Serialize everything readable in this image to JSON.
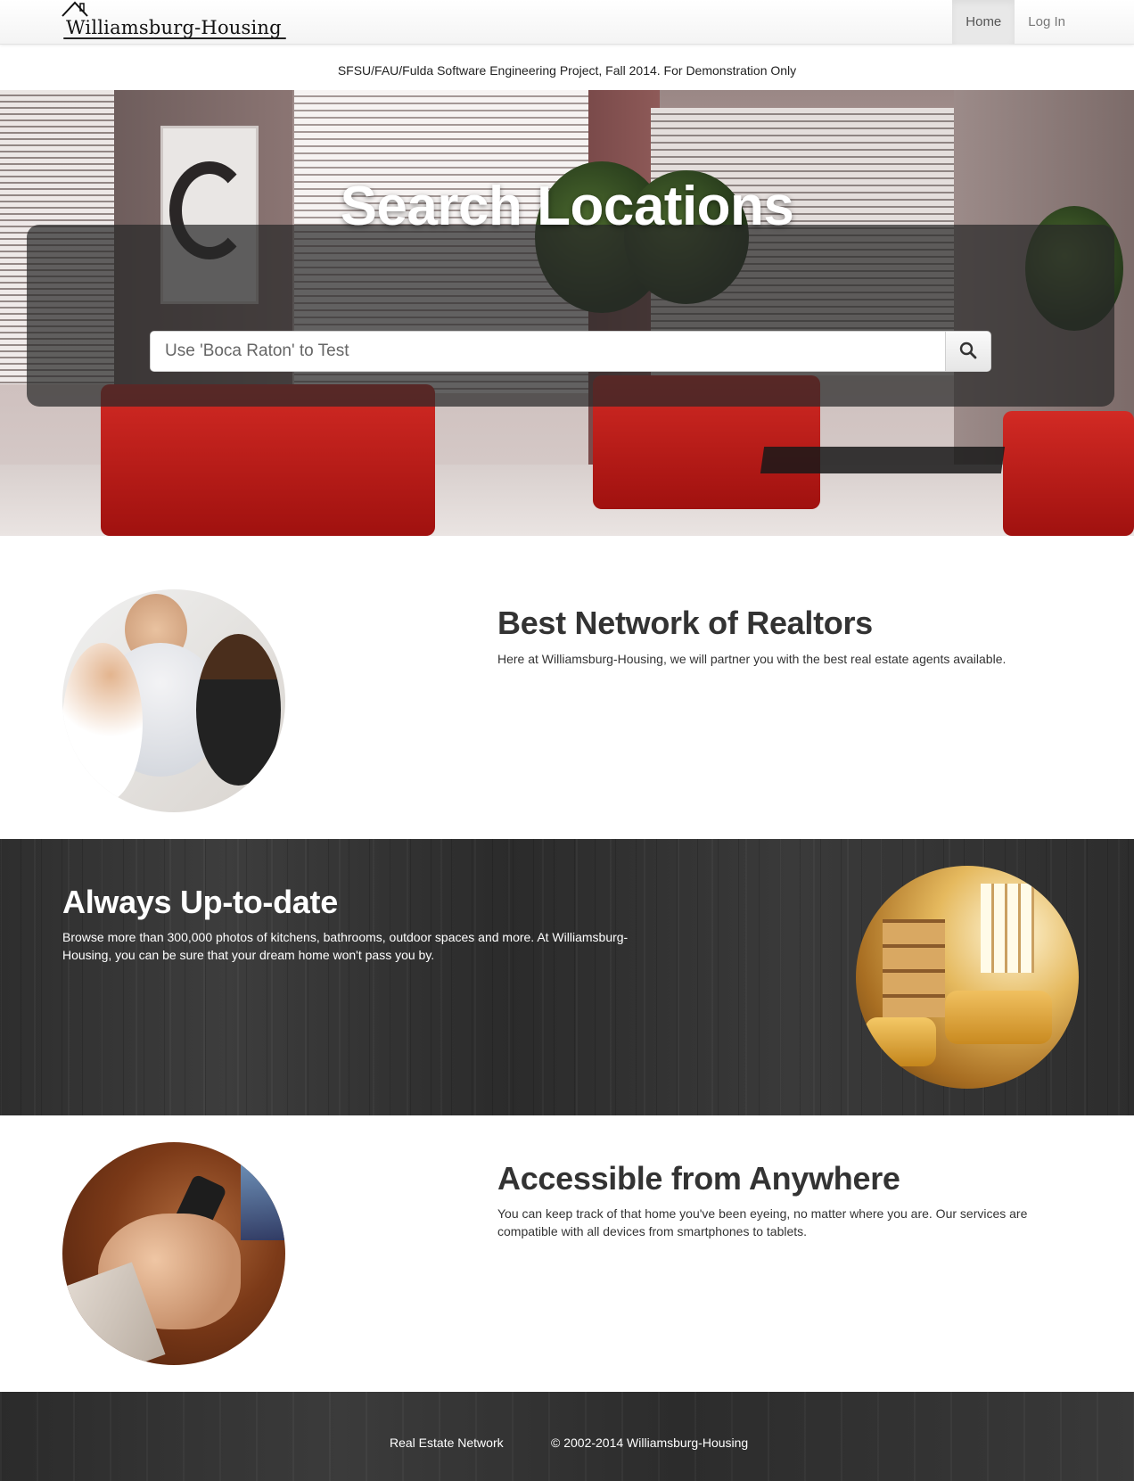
{
  "navbar": {
    "brand": "Williamsburg-Housing",
    "links": [
      {
        "label": "Home",
        "active": true
      },
      {
        "label": "Log In",
        "active": false
      }
    ]
  },
  "notice": "SFSU/FAU/Fulda Software Engineering Project, Fall 2014. For Demonstration Only",
  "hero": {
    "title": "Search Locations",
    "search_placeholder": "Use 'Boca Raton' to Test",
    "search_value": "",
    "search_button_icon": "search-icon"
  },
  "features": [
    {
      "title": "Best Network of Realtors",
      "text": "Here at Williamsburg-Housing, we will partner you with the best real estate agents available.",
      "image": "realtors-photo"
    },
    {
      "title": "Always Up-to-date",
      "text": "Browse more than 300,000 photos of kitchens, bathrooms, outdoor spaces and more. At Williamsburg-Housing, you can be sure that your dream home won't pass you by.",
      "image": "living-room-photo"
    },
    {
      "title": "Accessible from Anywhere",
      "text": "You can keep track of that home you've been eyeing, no matter where you are. Our services are compatible with all devices from smartphones to tablets.",
      "image": "smartphone-photo"
    }
  ],
  "footer": {
    "links": [
      "Real Estate Network",
      "© 2002-2014 Williamsburg-Housing"
    ]
  },
  "colors": {
    "hero_overlay": "#282828",
    "dark_section": "#333333",
    "chair_red": "#c0201c"
  }
}
